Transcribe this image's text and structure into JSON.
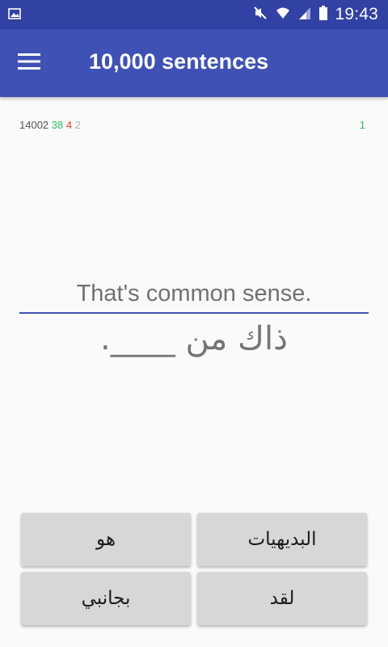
{
  "status_bar": {
    "time": "19:43",
    "icons": [
      "image-notification-icon",
      "mute-icon",
      "wifi-icon",
      "signal-icon",
      "battery-icon"
    ],
    "background": "#3241a4"
  },
  "toolbar": {
    "title": "10,000 sentences",
    "menu_icon": "hamburger-menu-icon",
    "background": "#3f51b5"
  },
  "stats": {
    "total": "14002",
    "correct": "38",
    "wrong": "4",
    "skipped": "2",
    "right_count": "1",
    "colors": {
      "correct": "#2eb85c",
      "wrong": "#e53935",
      "skipped": "#b0b0b0"
    }
  },
  "sentence": {
    "english": "That's common sense.",
    "arabic": "ذاك من ____."
  },
  "answers": [
    {
      "label": "هو"
    },
    {
      "label": "البديهيات"
    },
    {
      "label": "بجانبي"
    },
    {
      "label": "لقد"
    }
  ]
}
